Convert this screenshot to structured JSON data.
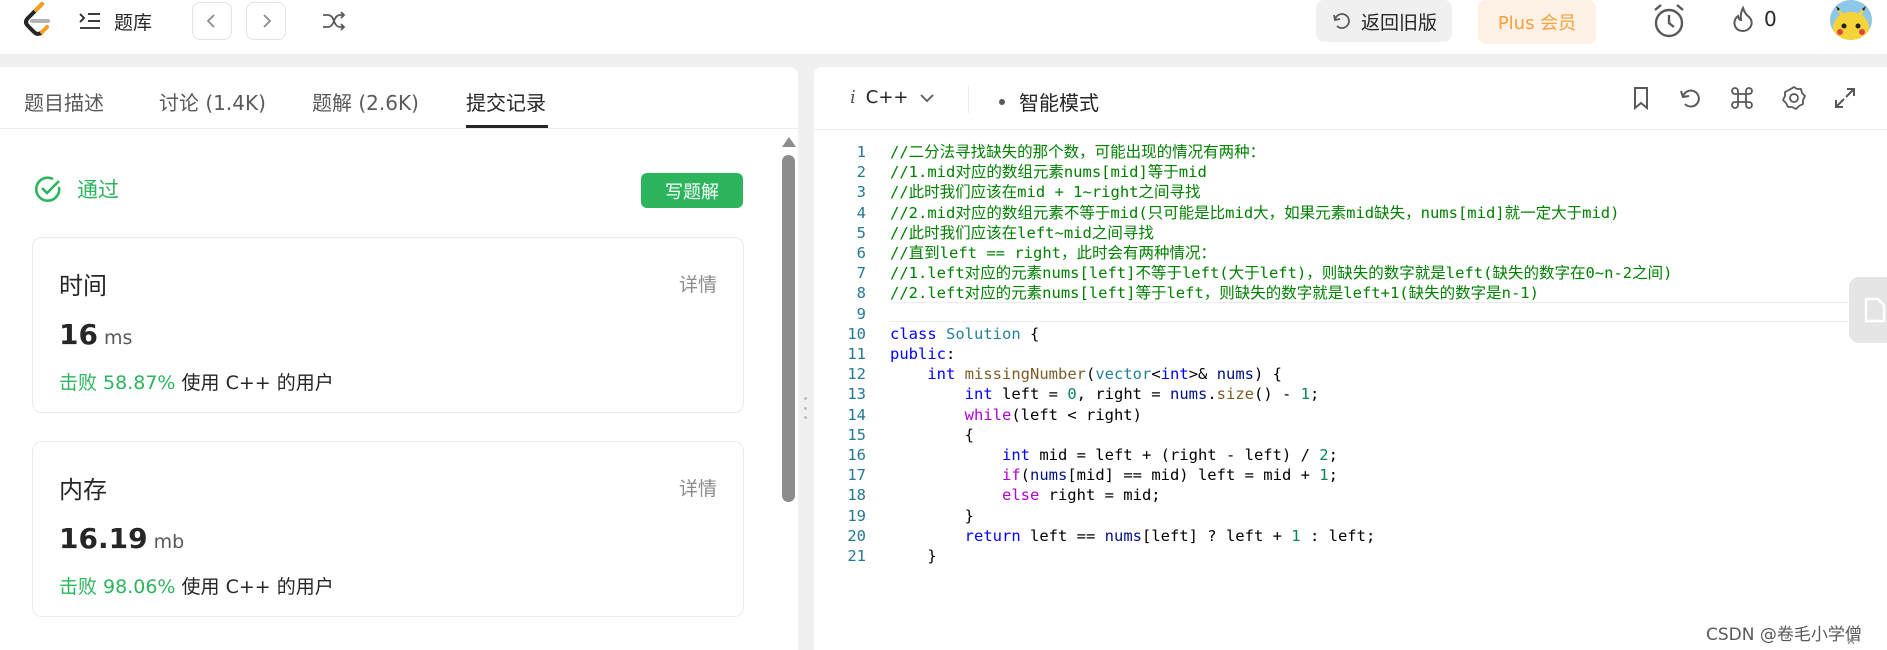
{
  "topbar": {
    "problem_bank_label": "题库",
    "back_old_label": "返回旧版",
    "plus_label": "Plus 会员",
    "streak_count": "0"
  },
  "left": {
    "tabs": [
      {
        "label": "题目描述"
      },
      {
        "label": "讨论 (1.4K)"
      },
      {
        "label": "题解 (2.6K)"
      },
      {
        "label": "提交记录"
      }
    ],
    "status_label": "通过",
    "write_solution_label": "写题解",
    "time_card": {
      "title": "时间",
      "detail_label": "详情",
      "value": "16",
      "unit": "ms",
      "beat_prefix": "击败 58.87%",
      "beat_suffix": "使用 C++ 的用户"
    },
    "memory_card": {
      "title": "内存",
      "detail_label": "详情",
      "value": "16.19",
      "unit": "mb",
      "beat_prefix": "击败 98.06%",
      "beat_suffix": "使用 C++ 的用户"
    }
  },
  "editor": {
    "language": "C++",
    "mode_label": "智能模式",
    "lines": [
      {
        "n": "1",
        "text": "//二分法寻找缺失的那个数，可能出现的情况有两种："
      },
      {
        "n": "2",
        "text": "//1.mid对应的数组元素nums[mid]等于mid"
      },
      {
        "n": "3",
        "text": "//此时我们应该在mid + 1~right之间寻找"
      },
      {
        "n": "4",
        "text": "//2.mid对应的数组元素不等于mid(只可能是比mid大，如果元素mid缺失，nums[mid]就一定大于mid)"
      },
      {
        "n": "5",
        "text": "//此时我们应该在left~mid之间寻找"
      },
      {
        "n": "6",
        "text": "//直到left == right，此时会有两种情况："
      },
      {
        "n": "7",
        "text": "//1.left对应的元素nums[left]不等于left(大于left)，则缺失的数字就是left(缺失的数字在0~n-2之间)"
      },
      {
        "n": "8",
        "text": "//2.left对应的元素nums[left]等于left，则缺失的数字就是left+1(缺失的数字是n-1)"
      },
      {
        "n": "9",
        "text": ""
      },
      {
        "n": "10",
        "text": "class Solution {"
      },
      {
        "n": "11",
        "text": "public:"
      },
      {
        "n": "12",
        "text": "    int missingNumber(vector<int>& nums) {"
      },
      {
        "n": "13",
        "text": "        int left = 0, right = nums.size() - 1;"
      },
      {
        "n": "14",
        "text": "        while(left < right)"
      },
      {
        "n": "15",
        "text": "        {"
      },
      {
        "n": "16",
        "text": "            int mid = left + (right - left) / 2;"
      },
      {
        "n": "17",
        "text": "            if(nums[mid] == mid) left = mid + 1;"
      },
      {
        "n": "18",
        "text": "            else right = mid;"
      },
      {
        "n": "19",
        "text": "        }"
      },
      {
        "n": "20",
        "text": "        return left == nums[left] ? left + 1 : left;"
      },
      {
        "n": "21",
        "text": "    }"
      }
    ]
  },
  "watermark": "CSDN @卷毛小学僧",
  "colors": {
    "accent_green": "#2db55d",
    "plus_orange": "#f5a13c",
    "comment_green": "#008000",
    "keyword_blue": "#0000ff",
    "control_purple": "#af00db",
    "line_number": "#237893"
  }
}
